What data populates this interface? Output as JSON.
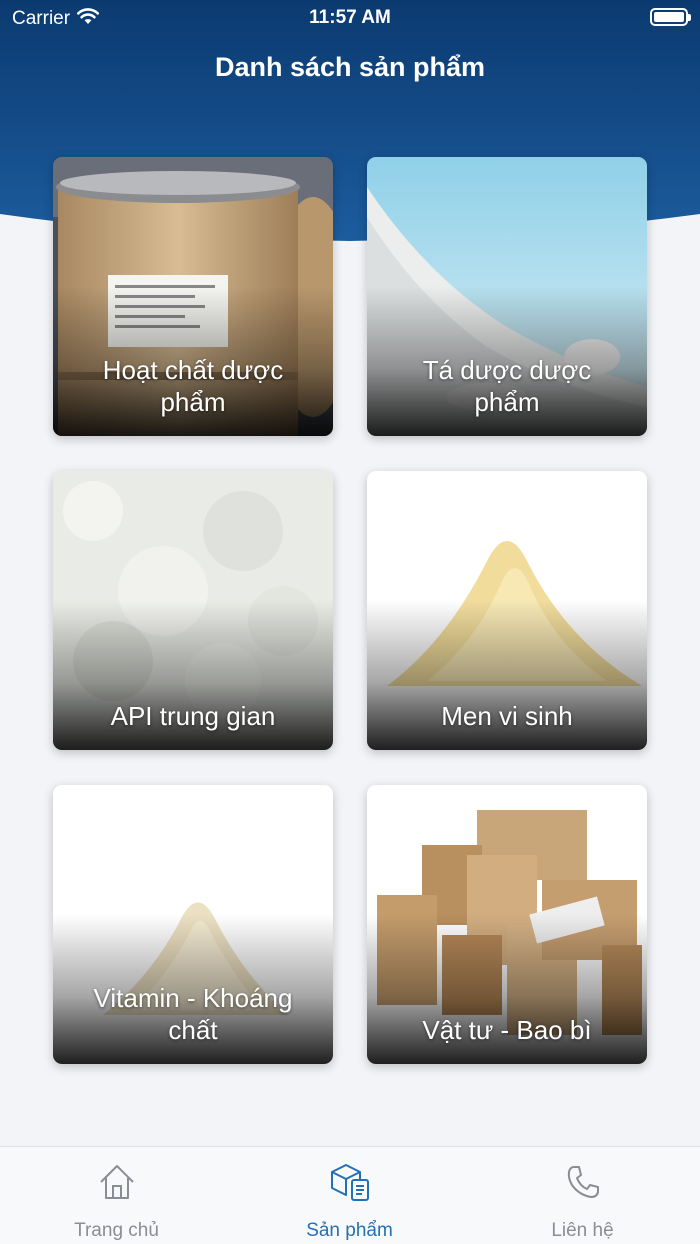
{
  "status_bar": {
    "carrier": "Carrier",
    "time": "11:57 AM"
  },
  "header": {
    "title": "Danh sách sản phẩm"
  },
  "products": [
    {
      "label": "Hoạt chất dược phẩm",
      "image": "drum-barrels-photo"
    },
    {
      "label": "Tá dược dược phẩm",
      "image": "white-powder-pile-photo"
    },
    {
      "label": "API trung gian",
      "image": "powder-texture-photo"
    },
    {
      "label": "Men vi sinh",
      "image": "yellow-powder-heap-photo"
    },
    {
      "label": "Vitamin - Khoáng chất",
      "image": "cream-powder-heap-photo"
    },
    {
      "label": "Vật tư - Bao bì",
      "image": "cardboard-boxes-photo"
    }
  ],
  "tabbar": {
    "items": [
      {
        "label": "Trang chủ",
        "icon": "home-icon",
        "active": false
      },
      {
        "label": "Sản phẩm",
        "icon": "product-box-icon",
        "active": true
      },
      {
        "label": "Liên hệ",
        "icon": "phone-icon",
        "active": false
      }
    ]
  },
  "colors": {
    "header_dark": "#0c3a6e",
    "header_light": "#1a5ea3",
    "background": "#f2f4f8",
    "tab_active": "#2470b5",
    "tab_inactive": "#8a8d93"
  }
}
